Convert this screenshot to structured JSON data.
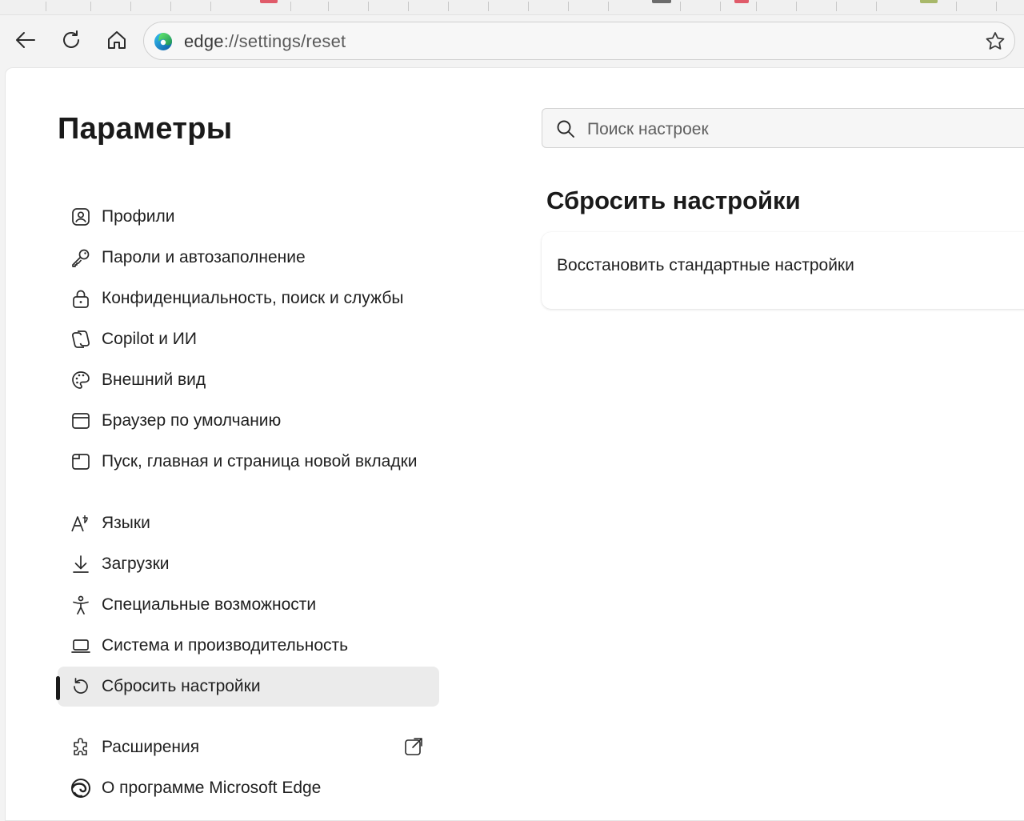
{
  "browser": {
    "address_bar": {
      "url_host": "edge",
      "url_rest": "://settings/reset"
    }
  },
  "settings": {
    "page_title": "Параметры",
    "search_placeholder": "Поиск настроек",
    "nav_items": [
      {
        "label": "Профили",
        "icon": "profile-icon"
      },
      {
        "label": "Пароли и автозаполнение",
        "icon": "key-icon"
      },
      {
        "label": "Конфиденциальность, поиск и службы",
        "icon": "lock-icon"
      },
      {
        "label": "Copilot и ИИ",
        "icon": "copilot-icon"
      },
      {
        "label": "Внешний вид",
        "icon": "palette-icon"
      },
      {
        "label": "Браузер по умолчанию",
        "icon": "browser-window-icon"
      },
      {
        "label": "Пуск, главная и страница новой вкладки",
        "icon": "new-tab-icon"
      },
      {
        "label": "Языки",
        "icon": "language-icon"
      },
      {
        "label": "Загрузки",
        "icon": "download-icon"
      },
      {
        "label": "Специальные возможности",
        "icon": "accessibility-icon"
      },
      {
        "label": "Система и производительность",
        "icon": "laptop-icon"
      },
      {
        "label": "Сбросить настройки",
        "icon": "reset-icon",
        "selected": true
      },
      {
        "label": "Расширения",
        "icon": "puzzle-icon"
      },
      {
        "label": "О программе Microsoft Edge",
        "icon": "edge-logo-icon"
      }
    ],
    "section_title": "Сбросить настройки",
    "card": {
      "row_label": "Восстановить стандартные настройки"
    }
  },
  "colors": {
    "accent": "#0f6cbd",
    "selected_bg": "#ebebeb",
    "indicator": "#1a1a1a"
  }
}
